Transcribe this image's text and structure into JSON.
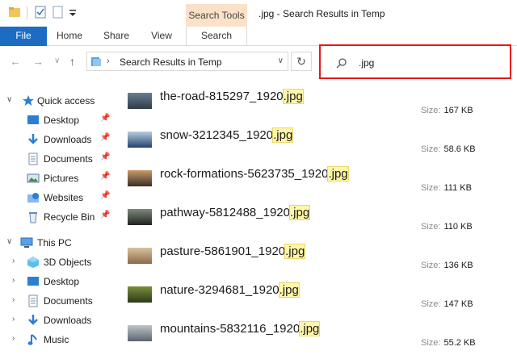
{
  "window": {
    "title": ".jpg - Search Results in Temp",
    "context_tab_header": "Search Tools"
  },
  "ribbon": {
    "tabs": [
      "File",
      "Home",
      "Share",
      "View",
      "Search"
    ]
  },
  "address": {
    "path": "Search Results in Temp"
  },
  "search": {
    "value": ".jpg",
    "match": ".jpg"
  },
  "sidebar": {
    "quick_access": "Quick access",
    "qa_items": [
      "Desktop",
      "Downloads",
      "Documents",
      "Pictures",
      "Websites",
      "Recycle Bin"
    ],
    "this_pc": "This PC",
    "pc_items": [
      "3D Objects",
      "Desktop",
      "Documents",
      "Downloads",
      "Music"
    ]
  },
  "results": {
    "size_label": "Size:",
    "items": [
      {
        "stem": "the-road-815297_1920",
        "size": "167 KB",
        "colors": [
          "#2e3b4a",
          "#6b7f8f"
        ]
      },
      {
        "stem": "snow-3212345_1920",
        "size": "58.6 KB",
        "colors": [
          "#24416e",
          "#b8cde0"
        ]
      },
      {
        "stem": "rock-formations-5623735_1920",
        "size": "111 KB",
        "colors": [
          "#3a2e28",
          "#c89a6a"
        ]
      },
      {
        "stem": "pathway-5812488_1920",
        "size": "110 KB",
        "colors": [
          "#1f2320",
          "#7d8a7a"
        ]
      },
      {
        "stem": "pasture-5861901_1920",
        "size": "136 KB",
        "colors": [
          "#8a6a4a",
          "#d9c3a0"
        ]
      },
      {
        "stem": "nature-3294681_1920",
        "size": "147 KB",
        "colors": [
          "#2a3a1a",
          "#7a8f3a"
        ]
      },
      {
        "stem": "mountains-5832116_1920",
        "size": "55.2 KB",
        "colors": [
          "#5a6470",
          "#c0c4c8"
        ]
      }
    ]
  }
}
